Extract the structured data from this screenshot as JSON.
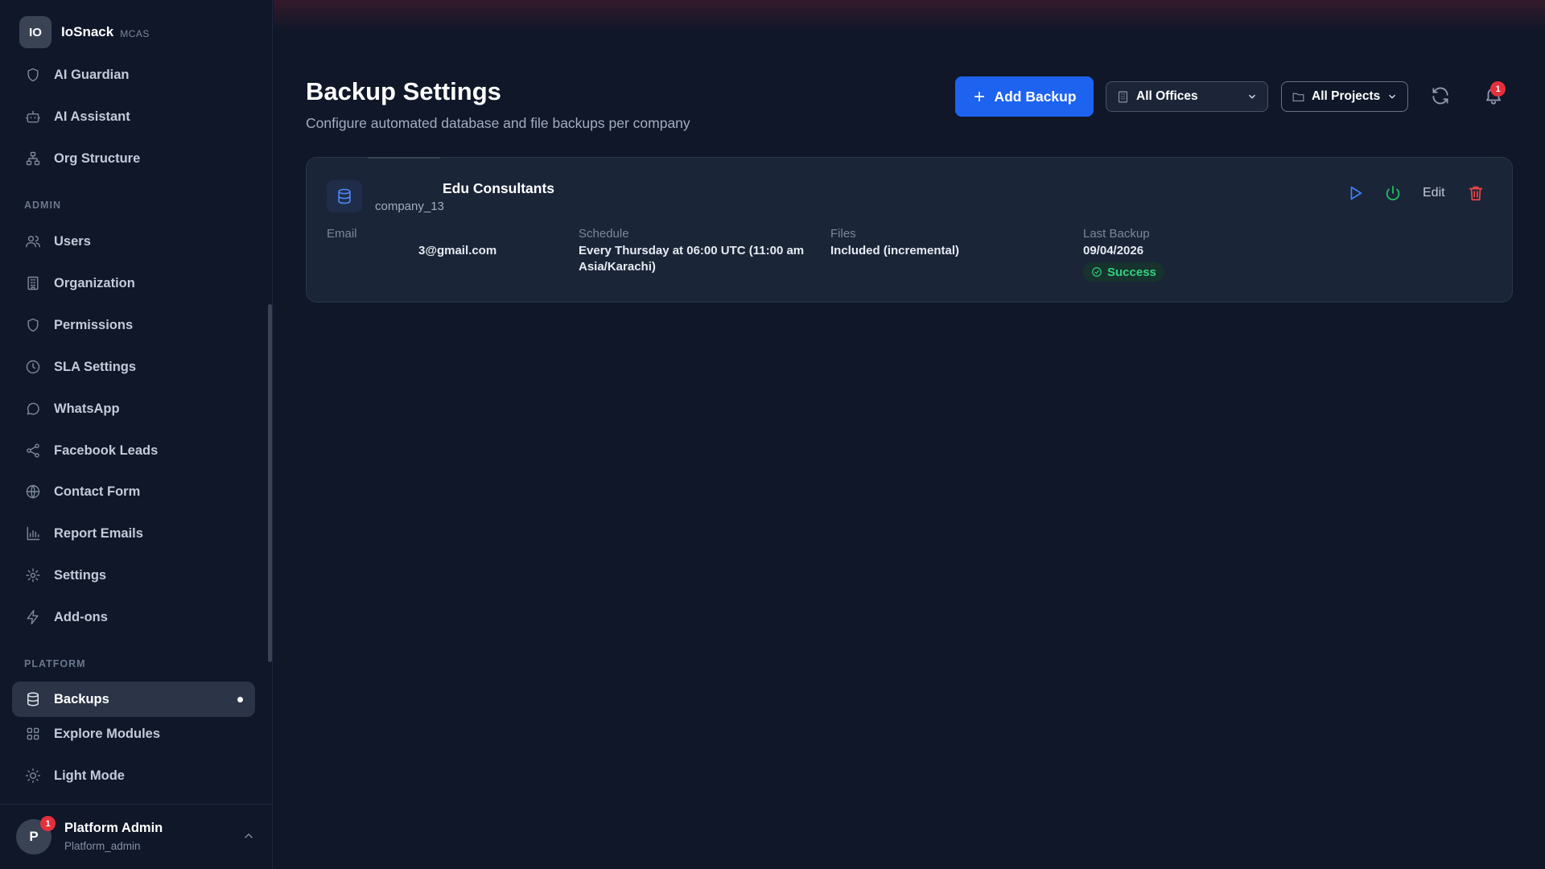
{
  "brand": {
    "logo": "IO",
    "name": "IoSnack",
    "sub": "MCAS"
  },
  "nav_top": [
    {
      "label": "AI Guardian",
      "icon": "shield-icon"
    },
    {
      "label": "AI Assistant",
      "icon": "bot-icon"
    },
    {
      "label": "Org Structure",
      "icon": "org-chart-icon"
    }
  ],
  "section_admin": "ADMIN",
  "nav_admin": [
    {
      "label": "Users",
      "icon": "users-icon"
    },
    {
      "label": "Organization",
      "icon": "building-icon"
    },
    {
      "label": "Permissions",
      "icon": "shield-icon"
    },
    {
      "label": "SLA Settings",
      "icon": "clock-icon"
    },
    {
      "label": "WhatsApp",
      "icon": "chat-bubble-icon"
    },
    {
      "label": "Facebook Leads",
      "icon": "share-icon"
    },
    {
      "label": "Contact Form",
      "icon": "globe-icon"
    },
    {
      "label": "Report Emails",
      "icon": "bar-chart-icon"
    },
    {
      "label": "Settings",
      "icon": "gear-icon"
    },
    {
      "label": "Add-ons",
      "icon": "lightning-icon"
    }
  ],
  "section_platform": "PLATFORM",
  "nav_platform": [
    {
      "label": "Backups",
      "icon": "database-icon",
      "active": true
    },
    {
      "label": "Explore Modules",
      "icon": "grid-icon"
    },
    {
      "label": "Light Mode",
      "icon": "sun-icon"
    }
  ],
  "user": {
    "avatar": "P",
    "badge": "1",
    "name": "Platform Admin",
    "role": "Platform_admin"
  },
  "header": {
    "title": "Backup Settings",
    "subtitle": "Configure automated database and file backups per company",
    "add_button": "Add Backup",
    "offices_select": "All Offices",
    "projects_select": "All Projects",
    "notification_count": "1"
  },
  "backup": {
    "company_name": "Edu Consultants",
    "company_id": "company_13",
    "email_label": "Email",
    "email_value": "3@gmail.com",
    "schedule_label": "Schedule",
    "schedule_value_line1": "Every Thursday at 06:00 UTC (11:00 am",
    "schedule_value_line2": "Asia/Karachi)",
    "files_label": "Files",
    "files_value": "Included (incremental)",
    "last_backup_label": "Last Backup",
    "last_backup_date": "09/04/2026",
    "status": "Success",
    "edit_label": "Edit"
  },
  "colors": {
    "background": "#0f1729",
    "accent": "#1d63f0",
    "success": "#35d07f",
    "danger": "#ef4444"
  }
}
